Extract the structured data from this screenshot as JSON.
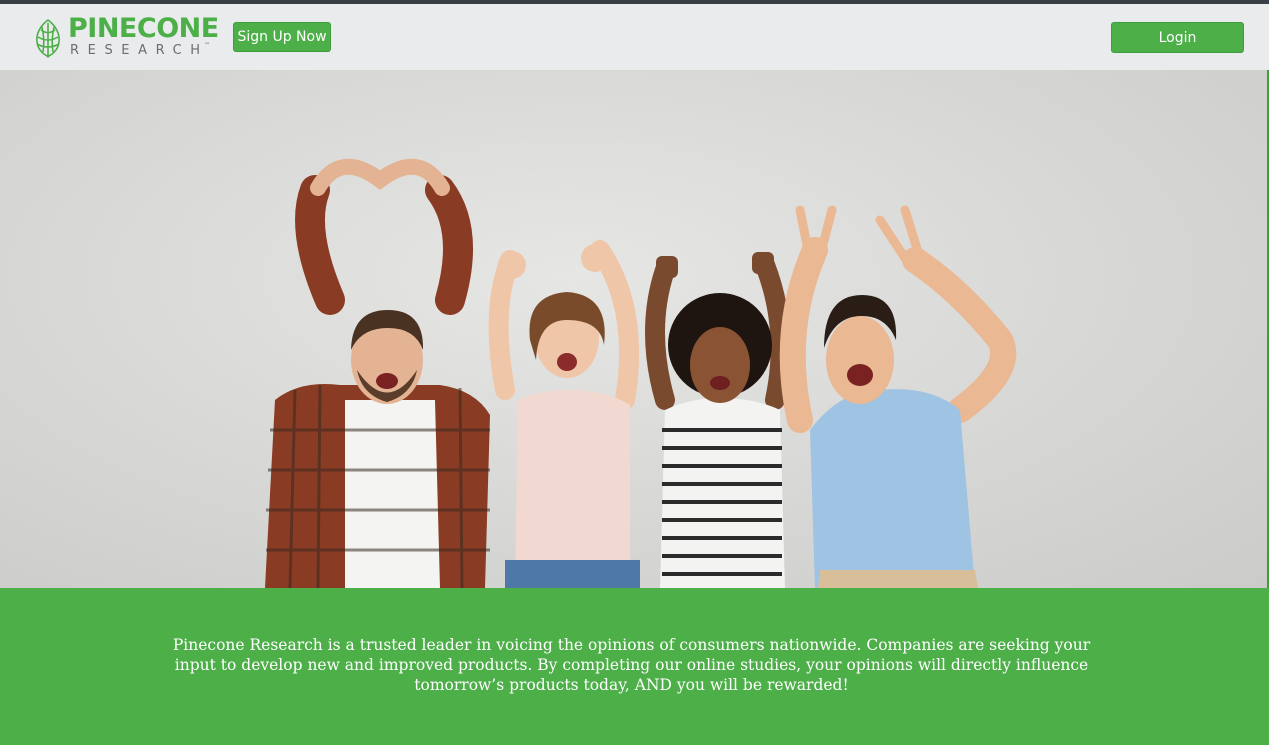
{
  "brand": {
    "name": "PINECONE",
    "sub": "RESEARCH",
    "tm": "™",
    "color": "#4caf48"
  },
  "nav": {
    "signup_label": "Sign Up Now",
    "login_label": "Login"
  },
  "hero": {
    "image": "group-of-four-cheering-people-photo"
  },
  "band": {
    "text": "Pinecone Research is a trusted leader in voicing the opinions of consumers nationwide. Companies are seeking your input to develop new and improved products. By completing our online studies, your opinions will directly influence tomorrow’s products today, AND you will be rewarded!",
    "color": "#4caf48"
  }
}
